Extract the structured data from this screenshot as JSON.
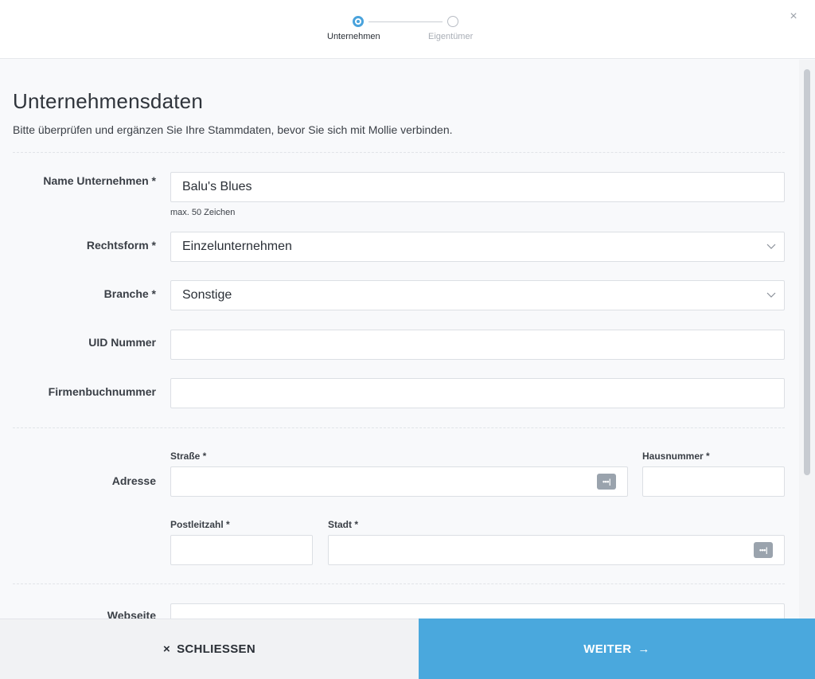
{
  "stepper": {
    "steps": [
      {
        "label": "Unternehmen",
        "state": "active"
      },
      {
        "label": "Eigentümer",
        "state": "inactive"
      }
    ]
  },
  "header": {
    "close_symbol": "×"
  },
  "form": {
    "title": "Unternehmensdaten",
    "subtitle": "Bitte überprüfen und ergänzen Sie Ihre Stammdaten, bevor Sie sich mit Mollie verbinden.",
    "company_name": {
      "label": "Name Unternehmen *",
      "value": "Balu's Blues",
      "hint": "max. 50 Zeichen"
    },
    "legal_form": {
      "label": "Rechtsform *",
      "value": "Einzelunternehmen"
    },
    "industry": {
      "label": "Branche *",
      "value": "Sonstige"
    },
    "uid_number": {
      "label": "UID Nummer",
      "value": ""
    },
    "registry_number": {
      "label": "Firmenbuchnummer",
      "value": ""
    },
    "address": {
      "label": "Adresse",
      "street_label": "Straße *",
      "house_number_label": "Hausnummer *",
      "postal_code_label": "Postleitzahl *",
      "city_label": "Stadt *",
      "street_value": "",
      "house_number_value": "",
      "postal_code_value": "",
      "city_value": ""
    },
    "website": {
      "label": "Webseite"
    }
  },
  "footer": {
    "close_label": "SCHLIESSEN",
    "close_icon": "×",
    "next_label": "WEITER",
    "next_icon": "→"
  },
  "colors": {
    "accent": "#4aa8dd",
    "step_active": "#4aa3dc"
  },
  "icons": {
    "password_manager": "password-manager-icon",
    "chevron": "chevron-down-icon"
  }
}
